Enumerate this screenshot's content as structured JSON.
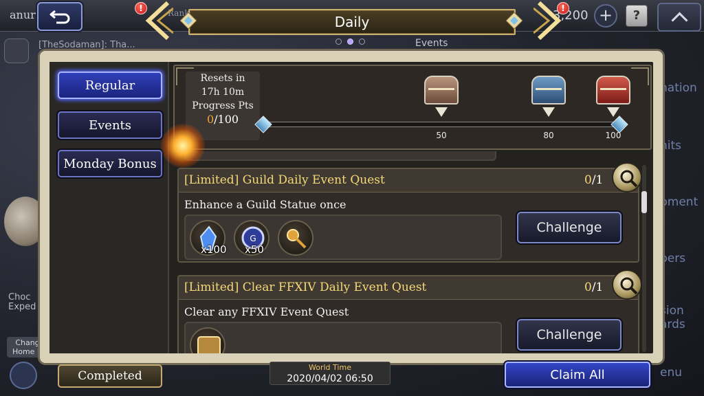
{
  "header": {
    "title": "Daily",
    "user_name": "anur",
    "rank_label": "Rank",
    "gil": "3,200",
    "page_dots": [
      false,
      true,
      false
    ],
    "help_label": "?",
    "plus_label": "+",
    "notification_badge": "!"
  },
  "background": {
    "chat_message": "[TheSodaman]: Tha...",
    "events_ghost": "Events",
    "left_text": "Choc\nExped",
    "left_text2": "Chang\nHome U",
    "right_rail": [
      "nation",
      "nits",
      "pment",
      "pers",
      "sion\nards",
      "enu"
    ]
  },
  "tabs": [
    {
      "label": "Regular",
      "active": true
    },
    {
      "label": "Events",
      "active": false
    },
    {
      "label": "Monday Bonus",
      "active": false
    }
  ],
  "progress": {
    "resets_label": "Resets in",
    "resets_time": "17h 10m",
    "pts_label": "Progress Pts",
    "current": "0",
    "max": "/100",
    "current_value": 0,
    "milestones": [
      {
        "value": "50",
        "chest": "bronze",
        "chest_name": "bronze-chest"
      },
      {
        "value": "80",
        "chest": "blue",
        "chest_name": "blue-chest"
      },
      {
        "value": "100",
        "chest": "red",
        "chest_name": "red-chest"
      }
    ]
  },
  "quests": [
    {
      "title": "[Limited] Guild Daily Event Quest",
      "count_current": "0",
      "count_max": "/1",
      "description": "Enhance a Guild Statue once",
      "rewards": [
        {
          "icon": "blue-crystal-icon",
          "qty": "x100"
        },
        {
          "icon": "guild-medal-icon",
          "qty": "x50"
        },
        {
          "icon": "gold-key-icon",
          "qty": ""
        }
      ],
      "button": "Challenge"
    },
    {
      "title": "[Limited] Clear FFXIV Daily Event Quest",
      "count_current": "0",
      "count_max": "/1",
      "description": "Clear any FFXIV Event Quest",
      "rewards": [
        {
          "icon": "gold-item-icon",
          "qty": ""
        }
      ],
      "button": "Challenge"
    }
  ],
  "footer": {
    "completed": "Completed",
    "world_time_label": "World Time",
    "world_time_value": "2020/04/02 06:50",
    "claim_all": "Claim All"
  },
  "colors": {
    "accent_blue": "#3246c6",
    "gold_text": "#f5d978",
    "progress_orange": "#f0a13d",
    "panel_frame": "#d9d2b8"
  }
}
